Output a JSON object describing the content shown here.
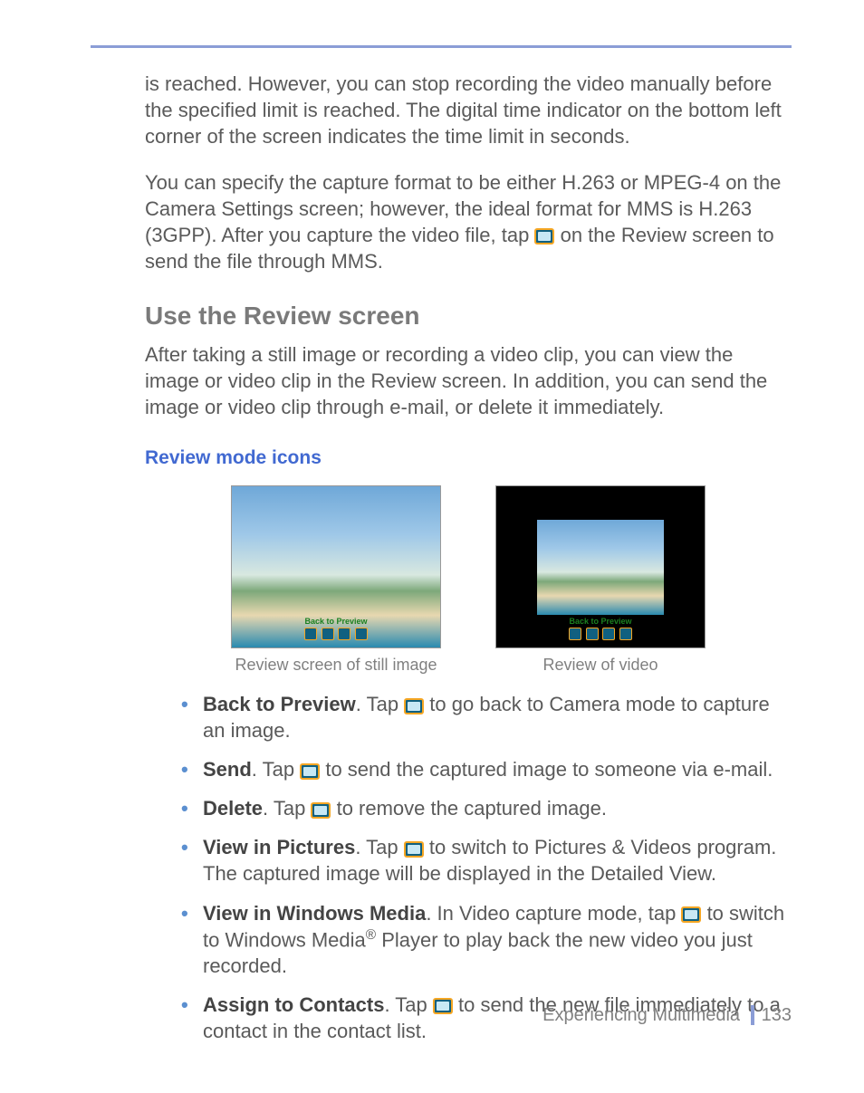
{
  "paragraphs": {
    "p1": "is reached. However, you can stop recording the video manually before the specified limit is reached. The digital time indicator on the bottom left corner of the screen indicates the time limit in seconds.",
    "p2_pre": "You can specify the capture format to be either H.263 or MPEG-4 on the Camera Settings screen; however, the ideal format for MMS is H.263 (3GPP). After you capture the video file, tap ",
    "p2_post": " on the Review screen to send the file through MMS."
  },
  "headings": {
    "h2": "Use the Review screen",
    "h3": "Review mode icons"
  },
  "after_h2": "After taking a still image or recording a video clip, you can view the image or video clip in the Review screen. In addition, you can send the image or video clip through e-mail, or delete it immediately.",
  "figures": {
    "still_caption": "Review screen of still image",
    "video_caption": "Review of video",
    "bar_label": "Back to Preview"
  },
  "bullets": [
    {
      "bold": "Back to Preview",
      "pre": ". Tap ",
      "post": " to go back to Camera mode to capture an image."
    },
    {
      "bold": "Send",
      "pre": ". Tap ",
      "post": " to send the captured image to someone via e-mail."
    },
    {
      "bold": "Delete",
      "pre": ". Tap ",
      "post": " to remove the captured image."
    },
    {
      "bold": "View in Pictures",
      "pre": ". Tap ",
      "post": " to switch to Pictures & Videos program. The captured image will be displayed in the Detailed View."
    },
    {
      "bold": "View in Windows Media",
      "pre": ". In Video capture mode, tap ",
      "post_a": " to switch to Windows Media",
      "reg": "®",
      "post_b": " Player to play back the new video you just recorded."
    },
    {
      "bold": "Assign to Contacts",
      "pre": ". Tap ",
      "post": " to send the new file immediately to a contact in the contact list."
    }
  ],
  "footer": {
    "section": "Experiencing Multimedia",
    "page": "133"
  }
}
